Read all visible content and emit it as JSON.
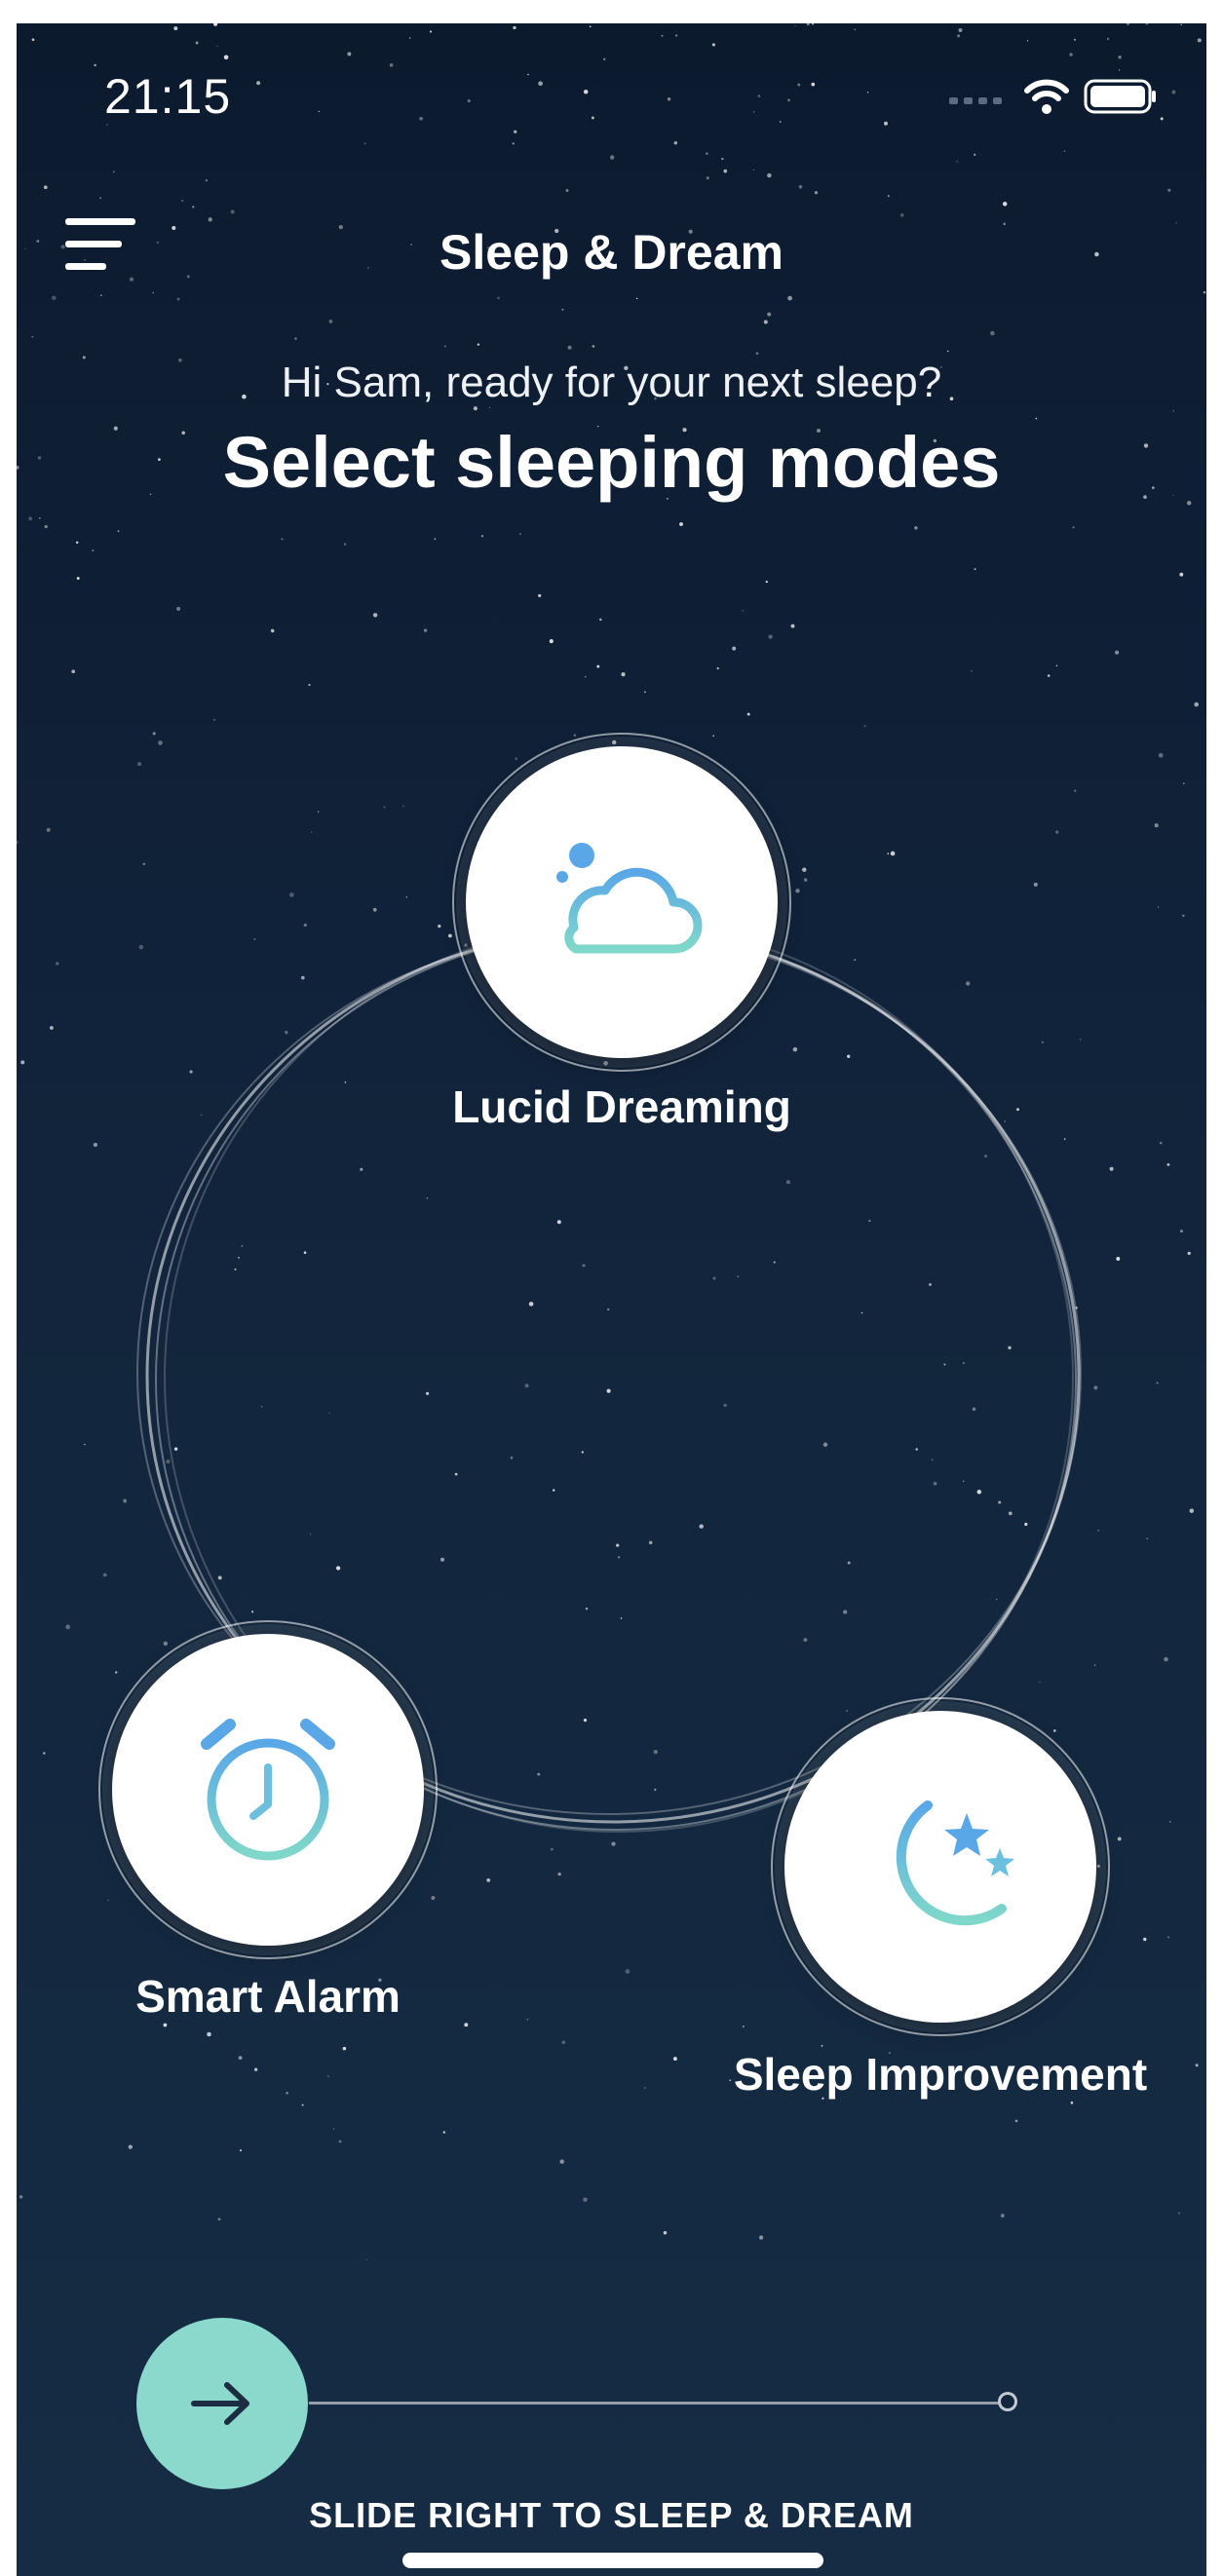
{
  "status_bar": {
    "time": "21:15",
    "icons": [
      "signal-icon",
      "wifi-icon",
      "battery-icon"
    ]
  },
  "header": {
    "title": "Sleep & Dream",
    "menu_icon": "menu-icon"
  },
  "greeting": "Hi Sam, ready for your next sleep?",
  "headline": "Select sleeping modes",
  "modes": [
    {
      "label": "Lucid Dreaming",
      "icon": "cloud-icon"
    },
    {
      "label": "Smart Alarm",
      "icon": "alarm-clock-icon"
    },
    {
      "label": "Sleep Improvement",
      "icon": "moon-stars-icon"
    }
  ],
  "slider": {
    "label": "SLIDE RIGHT TO SLEEP & DREAM",
    "icon": "arrow-right-icon",
    "progress": 0
  },
  "colors": {
    "background_top": "#0c1a2e",
    "background_bottom": "#152c44",
    "accent_teal": "#8bd9cc",
    "icon_blue": "#5aa7e8",
    "icon_teal": "#7fd8c9"
  }
}
